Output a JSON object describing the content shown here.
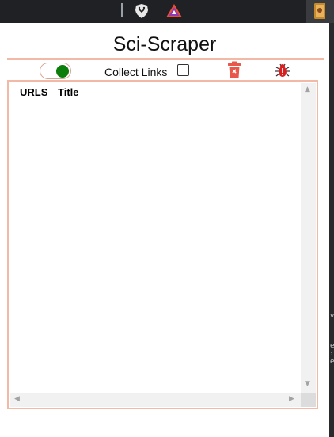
{
  "browser": {
    "extensions": [
      {
        "name": "brave-shield-icon"
      },
      {
        "name": "brave-rewards-icon"
      },
      {
        "name": "extension-icon"
      }
    ]
  },
  "popup": {
    "title": "Sci-Scraper",
    "toggle_on": true,
    "collect_links_label": "Collect Links",
    "collect_links_checked": false,
    "table": {
      "columns": [
        "URLS",
        "Title"
      ],
      "rows": []
    }
  },
  "colors": {
    "accent": "#f1b9a6",
    "toggle_knob": "#0a7d0a",
    "trash": "#e8574a",
    "bug": "#d81f1f"
  }
}
